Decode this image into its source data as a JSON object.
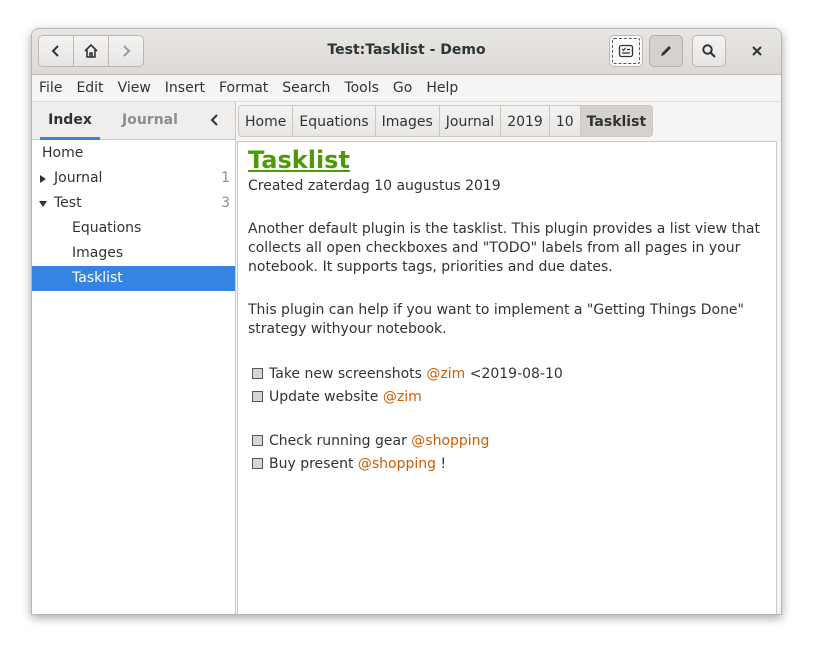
{
  "window": {
    "title": "Test:Tasklist - Demo"
  },
  "header": {
    "buttons": [
      "back",
      "home",
      "forward",
      "tasklist",
      "edit",
      "search",
      "close"
    ]
  },
  "menu": [
    "File",
    "Edit",
    "View",
    "Insert",
    "Format",
    "Search",
    "Tools",
    "Go",
    "Help"
  ],
  "sidebar": {
    "tabs": {
      "index": "Index",
      "journal": "Journal"
    },
    "tree": [
      {
        "label": "Home",
        "count": "",
        "expander": ""
      },
      {
        "label": "Journal",
        "count": "1",
        "expander": "collapsed"
      },
      {
        "label": "Test",
        "count": "3",
        "expander": "expanded"
      },
      {
        "label": "Equations",
        "count": "",
        "expander": ""
      },
      {
        "label": "Images",
        "count": "",
        "expander": ""
      },
      {
        "label": "Tasklist",
        "count": "",
        "expander": "",
        "selected": true
      }
    ]
  },
  "pathbar": [
    "Home",
    "Equations",
    "Images",
    "Journal",
    "2019",
    "10",
    "Tasklist"
  ],
  "page": {
    "heading": "Tasklist",
    "created": "Created zaterdag 10 augustus 2019",
    "para1": "Another default plugin is the tasklist. This plugin provides a list view that collects all open checkboxes and \"TODO\" labels from all pages in your notebook. It supports tags, priorities and due dates.",
    "para2": "This plugin can help if you want to implement a \"Getting Things Done\" strategy withyour notebook.",
    "tasks": [
      {
        "text": "Take new screenshots ",
        "tag": "@zim",
        "after": " <2019-08-10"
      },
      {
        "text": "Update website ",
        "tag": "@zim",
        "after": ""
      },
      {
        "text": "Check running gear ",
        "tag": "@shopping",
        "after": ""
      },
      {
        "text": "Buy present ",
        "tag": "@shopping",
        "after": " !"
      }
    ]
  },
  "colors": {
    "accent": "#3584e4",
    "heading": "#4e9a06",
    "tag": "#ce5c00"
  }
}
